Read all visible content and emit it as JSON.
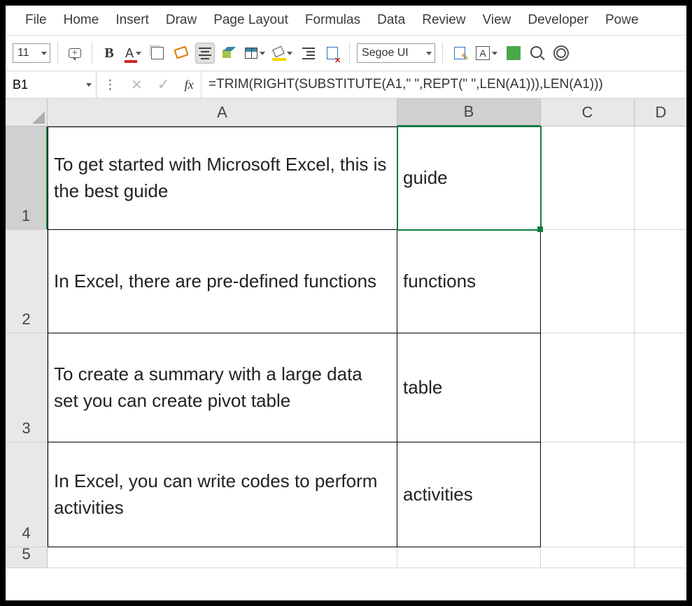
{
  "menu": {
    "items": [
      "File",
      "Home",
      "Insert",
      "Draw",
      "Page Layout",
      "Formulas",
      "Data",
      "Review",
      "View",
      "Developer",
      "Powe"
    ]
  },
  "toolbar": {
    "font_size": "11",
    "font_name": "Segoe UI",
    "a_box_label": "A"
  },
  "formula_bar": {
    "name_box": "B1",
    "fx_label": "fx",
    "formula": "=TRIM(RIGHT(SUBSTITUTE(A1,\" \",REPT(\" \",LEN(A1))),LEN(A1)))"
  },
  "columns": [
    "A",
    "B",
    "C",
    "D"
  ],
  "rows": [
    "1",
    "2",
    "3",
    "4",
    "5"
  ],
  "selected_cell": "B1",
  "cells": {
    "A1": "To get started with Microsoft Excel, this is the best guide",
    "B1": "guide",
    "A2": "In Excel, there are pre-defined functions",
    "B2": "functions",
    "A3": "To create a summary with a large data set you can create pivot table",
    "B3": "table",
    "A4": "In Excel, you can write codes to perform activities",
    "B4": "activities"
  }
}
